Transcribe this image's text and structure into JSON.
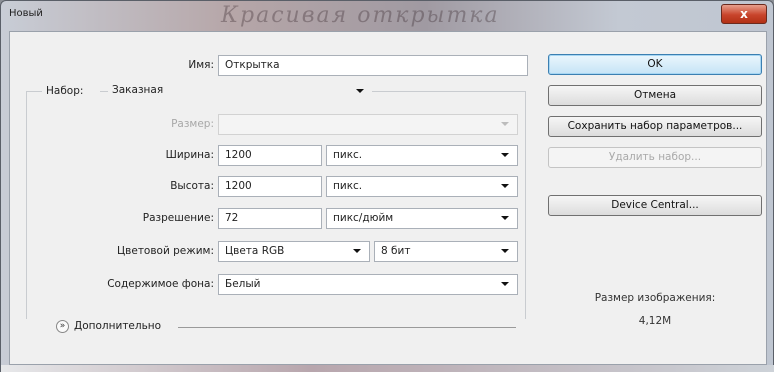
{
  "window": {
    "title": "Новый",
    "close_glyph": "x",
    "title_decoration": "Красивая открытка"
  },
  "form": {
    "name_label": "Имя:",
    "name_value": "Открытка",
    "preset_label": "Набор:",
    "preset_value": "Заказная",
    "size_label": "Размер:",
    "size_value": "",
    "width_label": "Ширина:",
    "width_value": "1200",
    "width_unit": "пикс.",
    "height_label": "Высота:",
    "height_value": "1200",
    "height_unit": "пикс.",
    "resolution_label": "Разрешение:",
    "resolution_value": "72",
    "resolution_unit": "пикс/дюйм",
    "color_mode_label": "Цветовой режим:",
    "color_mode_value": "Цвета RGB",
    "bit_depth_value": "8 бит",
    "background_label": "Содержимое фона:",
    "background_value": "Белый",
    "advanced_label": "Дополнительно",
    "advanced_toggle": "»"
  },
  "buttons": {
    "ok": "OK",
    "cancel": "Отмена",
    "save_preset": "Сохранить набор параметров...",
    "delete_preset": "Удалить набор...",
    "device_central": "Device Central..."
  },
  "image_size": {
    "label": "Размер изображения:",
    "value": "4,12M"
  }
}
